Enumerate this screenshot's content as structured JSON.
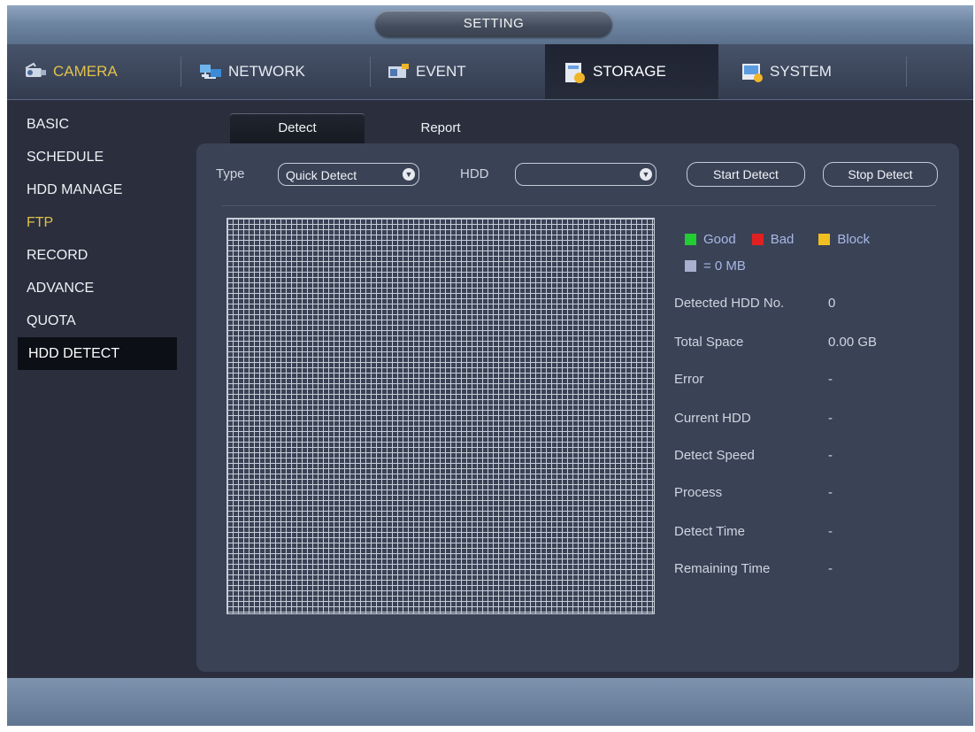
{
  "window": {
    "title": "SETTING"
  },
  "main_tabs": [
    {
      "label": "CAMERA",
      "icon": "camera-icon",
      "color": "#e2c24a"
    },
    {
      "label": "NETWORK",
      "icon": "network-icon"
    },
    {
      "label": "EVENT",
      "icon": "event-icon"
    },
    {
      "label": "STORAGE",
      "icon": "storage-icon",
      "active": true
    },
    {
      "label": "SYSTEM",
      "icon": "system-icon"
    }
  ],
  "sidebar": {
    "items": [
      {
        "label": "BASIC"
      },
      {
        "label": "SCHEDULE"
      },
      {
        "label": "HDD MANAGE"
      },
      {
        "label": "FTP",
        "color": "#e0c045"
      },
      {
        "label": "RECORD"
      },
      {
        "label": "ADVANCE"
      },
      {
        "label": "QUOTA"
      },
      {
        "label": "HDD DETECT",
        "active": true
      }
    ]
  },
  "sub_tabs": [
    {
      "label": "Detect",
      "active": true
    },
    {
      "label": "Report"
    }
  ],
  "toolbar": {
    "type_label": "Type",
    "type_value": "Quick Detect",
    "hdd_label": "HDD",
    "hdd_value": "",
    "start_button": "Start Detect",
    "stop_button": "Stop Detect"
  },
  "legend": {
    "good": {
      "label": "Good",
      "color": "#22cc33"
    },
    "bad": {
      "label": "Bad",
      "color": "#e02020"
    },
    "block": {
      "label": "Block",
      "color": "#f0c020"
    },
    "unit": {
      "label": "= 0 MB",
      "color": "#a8b0d0"
    }
  },
  "info": [
    {
      "label": "Detected HDD No.",
      "value": "0"
    },
    {
      "label": "Total Space",
      "value": "0.00 GB"
    },
    {
      "label": "Error",
      "value": "-"
    },
    {
      "label": "Current HDD",
      "value": "-"
    },
    {
      "label": "Detect Speed",
      "value": "-"
    },
    {
      "label": "Process",
      "value": "-"
    },
    {
      "label": "Detect Time",
      "value": "-"
    },
    {
      "label": "Remaining Time",
      "value": "-"
    }
  ],
  "colors": {
    "accent_yellow": "#e2c24a",
    "panel": "#3a4256",
    "titlebar": "#7088a5"
  }
}
